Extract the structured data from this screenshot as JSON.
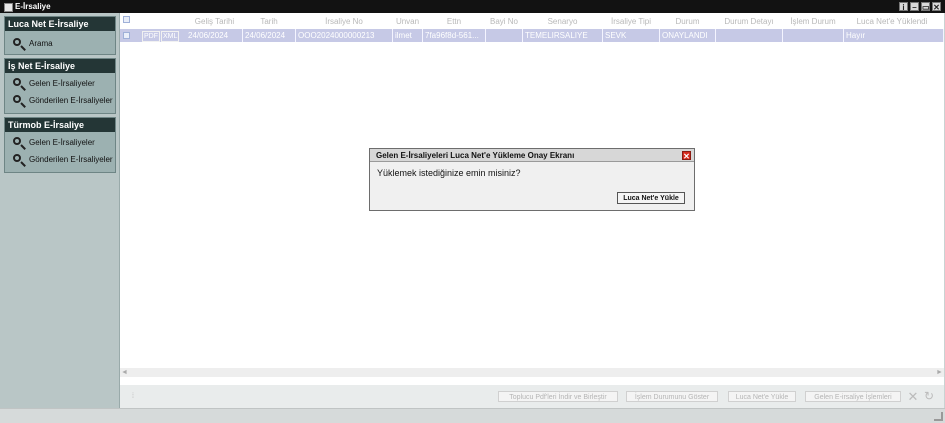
{
  "window": {
    "title": "E-İrsaliye",
    "buttons": [
      "i",
      "–",
      "▭",
      "✕"
    ]
  },
  "sidebar": {
    "luca": {
      "title": "Luca Net E-İrsaliye",
      "items": [
        "Arama"
      ]
    },
    "isnet": {
      "title": "İş Net E-İrsaliye",
      "items": [
        "Gelen E-İrsaliyeler",
        "Gönderilen E-İrsaliyeler"
      ]
    },
    "turmob": {
      "title": "Türmob E-İrsaliye",
      "items": [
        "Gelen E-İrsaliyeler",
        "Gönderilen E-İrsaliyeler"
      ]
    }
  },
  "grid": {
    "headers": [
      "Geliş Tarihi",
      "Tarih",
      "İrsaliye No",
      "Unvan",
      "Ettn",
      "Bayi No",
      "Senaryo",
      "İrsaliye Tipi",
      "Durum",
      "Durum Detayı",
      "İşlem Durum",
      "Luca Net'e Yüklendi"
    ],
    "row": {
      "pdf": "PDF",
      "xml": "XML",
      "gelis_tarihi": "24/06/2024",
      "tarih": "24/06/2024",
      "irsaliye_no": "OOO2024000000213",
      "unvan": "ilmet",
      "ettn": "7fa96f8d-561...",
      "bayi_no": "",
      "senaryo": "TEMELIRSALIYE",
      "tip": "SEVK",
      "durum": "ONAYLANDI",
      "durum_detayi": "",
      "islem_durum": "",
      "yuklendi": "Hayır"
    }
  },
  "bottom": {
    "buttons": [
      "Toplucu Pdf'leri İndir ve Birleştir",
      "İşlem Durumunu Göster",
      "Luca Net'e Yükle",
      "Gelen E-irsaliye İşlemleri"
    ]
  },
  "dialog": {
    "title": "Gelen E-İrsaliyeleri Luca Net'e Yükleme Onay Ekranı",
    "message": "Yüklemek istediğinize emin misiniz?",
    "confirm": "Luca Net'e Yükle"
  }
}
